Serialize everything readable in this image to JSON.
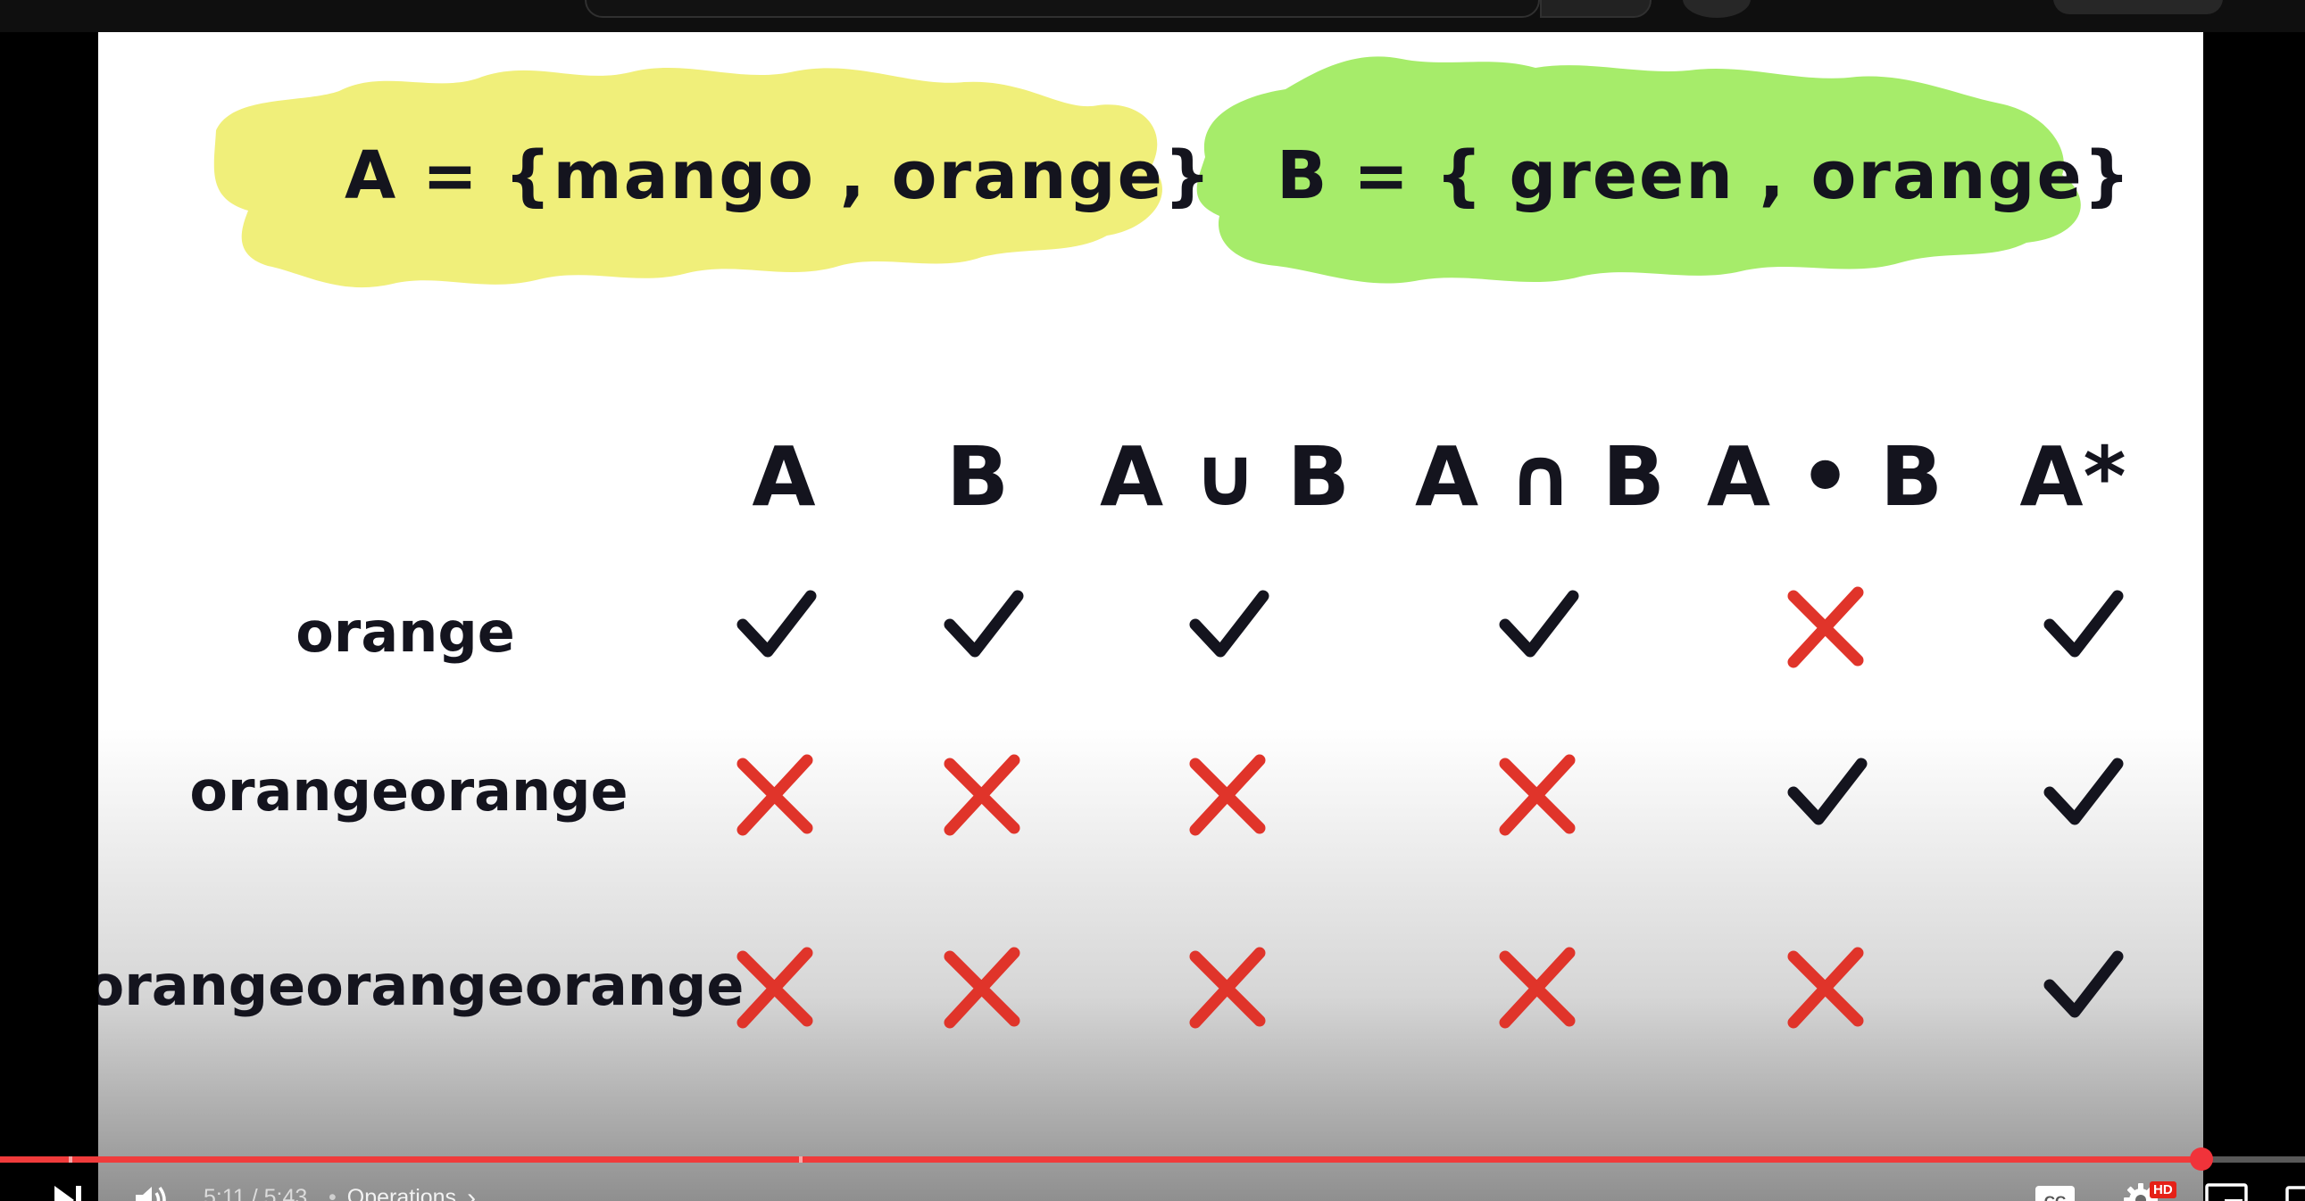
{
  "slide": {
    "set_a": "A = {mango , orange}",
    "set_b": "B = { green , orange}",
    "columns": [
      "A",
      "B",
      "A ∪ B",
      "A ∩ B",
      "A • B",
      "A*"
    ],
    "rows": [
      {
        "label": "orange",
        "marks": [
          "check",
          "check",
          "check",
          "check",
          "cross",
          "check"
        ]
      },
      {
        "label": "orangeorange",
        "marks": [
          "cross",
          "cross",
          "cross",
          "cross",
          "check",
          "check"
        ]
      },
      {
        "label": "orangeorangeorange",
        "marks": [
          "cross",
          "cross",
          "cross",
          "cross",
          "cross",
          "check"
        ]
      }
    ],
    "colors": {
      "set_a_highlight": "#f0ef7a",
      "set_b_highlight": "#a6ec6a",
      "check": "#14141e",
      "cross": "#e0342a"
    }
  },
  "player": {
    "current_time": "5:11",
    "duration": "5:43",
    "time_text": "5:11 / 5:43",
    "chapter_title": "Operations",
    "progress_fraction": 0.955,
    "hd_badge": "HD",
    "icons": [
      "next-icon",
      "volume-icon",
      "chevron-right-icon",
      "captions-icon",
      "settings-icon",
      "miniplayer-icon",
      "theater-icon"
    ]
  }
}
